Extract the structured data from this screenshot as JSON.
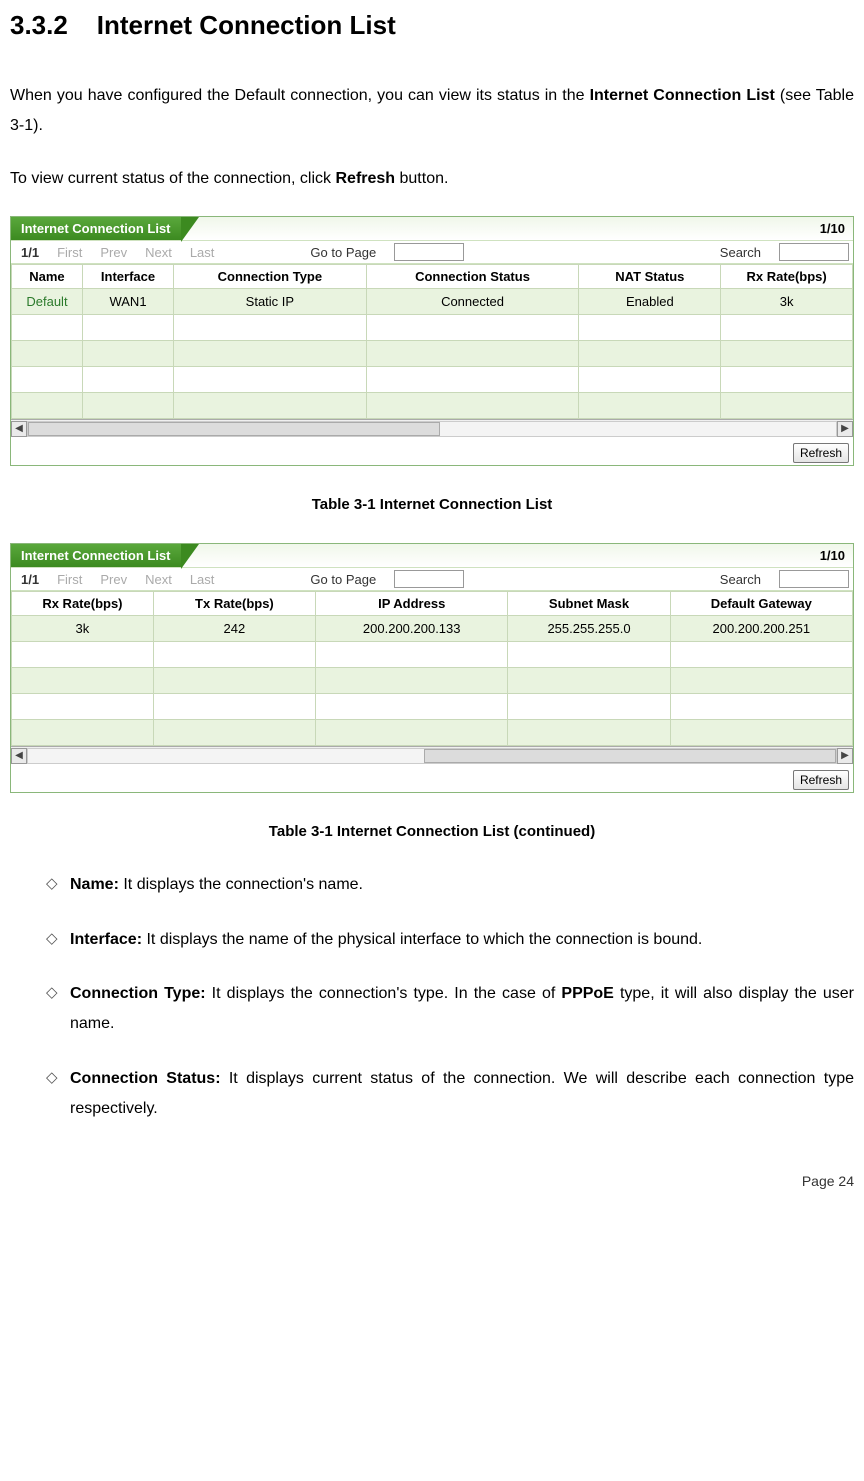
{
  "section": {
    "num": "3.3.2",
    "title": "Internet Connection List"
  },
  "para1_a": "When you have configured the Default connection, you can view its status in the ",
  "para1_b": "Internet Connection List",
  "para1_c": " (see Table 3-1).",
  "para2_a": "To view current status of the connection, click ",
  "para2_b": "Refresh",
  "para2_c": " button.",
  "panel_title": "Internet Connection List",
  "panel_page": "1/10",
  "pager": {
    "count": "1/1",
    "first": "First",
    "prev": "Prev",
    "next": "Next",
    "last": "Last",
    "goto": "Go to Page",
    "search": "Search"
  },
  "table1": {
    "headers": [
      "Name",
      "Interface",
      "Connection Type",
      "Connection Status",
      "NAT Status",
      "Rx Rate(bps)"
    ],
    "row": [
      "Default",
      "WAN1",
      "Static IP",
      "Connected",
      "Enabled",
      "3k"
    ]
  },
  "refresh": "Refresh",
  "caption1": "Table 3-1 Internet Connection List",
  "table2": {
    "headers": [
      "Rx Rate(bps)",
      "Tx Rate(bps)",
      "IP Address",
      "Subnet Mask",
      "Default Gateway"
    ],
    "row": [
      "3k",
      "242",
      "200.200.200.133",
      "255.255.255.0",
      "200.200.200.251"
    ]
  },
  "caption2": "Table 3-1 Internet Connection List (continued)",
  "desc": {
    "name_b": "Name:",
    "name_t": " It displays the connection's name.",
    "iface_b": "Interface:",
    "iface_t": " It displays the name of the physical interface to which the connection is bound.",
    "ctype_b": "Connection Type:",
    "ctype_t_a": " It displays the connection's type. In the case of ",
    "ctype_t_b": "PPPoE",
    "ctype_t_c": " type, it will also display the user name.",
    "cstat_b": "Connection Status:",
    "cstat_t": " It displays current status of the connection. We will describe each connection type respectively."
  },
  "page_footer": "Page  24"
}
